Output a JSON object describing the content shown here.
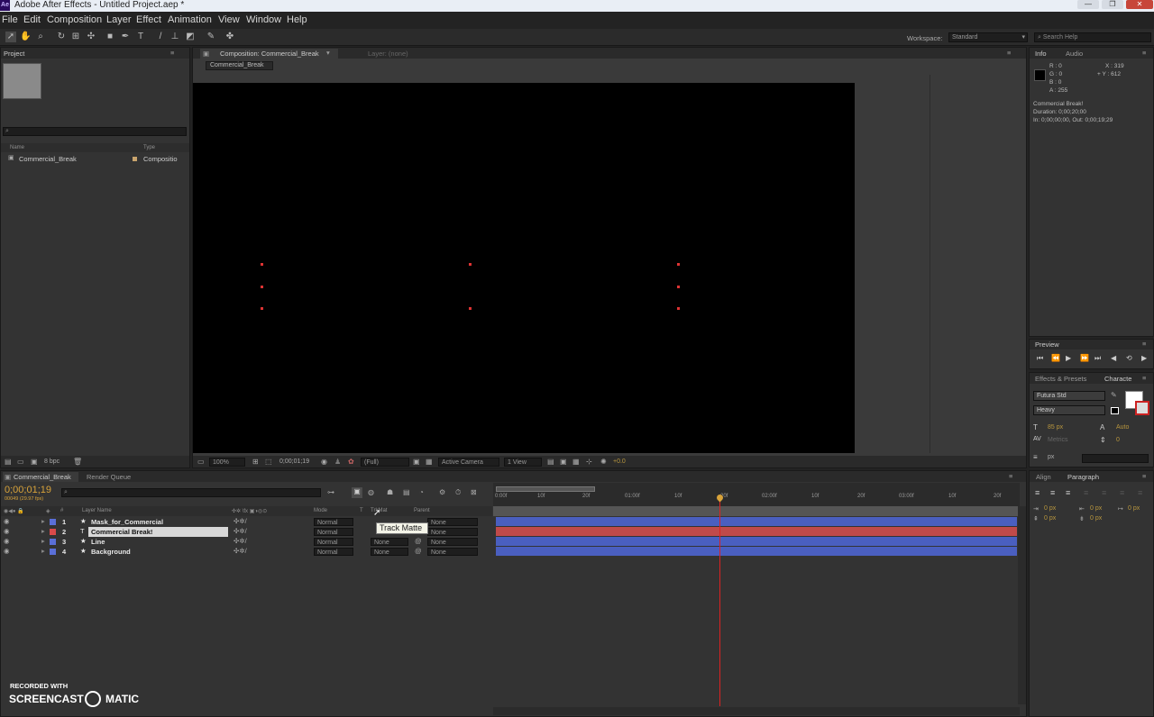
{
  "window": {
    "title": "Adobe After Effects - Untitled Project.aep *",
    "app_badge": "Ae"
  },
  "menu": [
    "File",
    "Edit",
    "Composition",
    "Layer",
    "Effect",
    "Animation",
    "View",
    "Window",
    "Help"
  ],
  "toolbar": {
    "workspace_label": "Workspace:",
    "workspace_value": "Standard",
    "search_placeholder": "Search Help"
  },
  "project": {
    "tab": "Project",
    "col_name": "Name",
    "col_type": "Type",
    "items": [
      {
        "name": "Commercial_Break",
        "type": "Compositio"
      }
    ],
    "bpc": "8 bpc"
  },
  "comp": {
    "tab": "Composition: Commercial_Break",
    "layer_tab": "Layer: (none)",
    "breadcrumb": "Commercial_Break",
    "zoom": "100%",
    "timecode": "0;00;01;19",
    "resolution": "(Full)",
    "camera": "Active Camera",
    "view": "1 View",
    "exposure": "+0.0"
  },
  "info": {
    "tab": "Info",
    "tab2": "Audio",
    "r": "R : 0",
    "g": "G : 0",
    "b": "B : 0",
    "a": "A : 255",
    "x": "X : 319",
    "y": "+ Y : 612",
    "line1": "Commercial Break!",
    "line2": "Duration: 0;00;20;00",
    "line3": "In: 0;00;00;00, Out: 0;00;19;29"
  },
  "preview": {
    "tab": "Preview"
  },
  "character": {
    "tab1": "Effects & Presets",
    "tab2": "Characte",
    "font": "Futura Std",
    "style": "Heavy",
    "size": "85 px",
    "leading": "Auto",
    "tracking": "0",
    "kerning": "Metrics",
    "unit": "px"
  },
  "paragraph": {
    "tab1": "Align",
    "tab2": "Paragraph",
    "v1": "0 px",
    "v2": "0 px",
    "v3": "0 px",
    "v4": "0 px",
    "v5": "0 px"
  },
  "timeline": {
    "tab": "Commercial_Break",
    "tab2": "Render Queue",
    "timecode": "0;00;01;19",
    "fps": "00049 (29.97 fps)",
    "col_layer": "Layer Name",
    "col_mode": "Mode",
    "col_t": "T",
    "col_trkmat": "TrkMat",
    "col_parent": "Parent",
    "tooltip": "Track Matte",
    "ticks": [
      "0:00f",
      "10f",
      "20f",
      "01:00f",
      "10f",
      "20f",
      "02:00f",
      "10f",
      "20f",
      "03:00f",
      "10f",
      "20f"
    ],
    "layers": [
      {
        "num": "1",
        "name": "Mask_for_Commercial",
        "mode": "Normal",
        "trkmat": "",
        "parent": "None",
        "label": "#5a6fd8",
        "bar": "#4a5fc0"
      },
      {
        "num": "2",
        "name": "Commercial Break!",
        "mode": "Normal",
        "trkmat": "N",
        "parent": "None",
        "label": "#d94a4a",
        "bar": "#c04a4a"
      },
      {
        "num": "3",
        "name": "Line",
        "mode": "Normal",
        "trkmat": "None",
        "parent": "None",
        "label": "#5a6fd8",
        "bar": "#4a5fc0"
      },
      {
        "num": "4",
        "name": "Background",
        "mode": "Normal",
        "trkmat": "None",
        "parent": "None",
        "label": "#5a6fd8",
        "bar": "#4a5fc0"
      }
    ]
  },
  "watermark": {
    "line1": "RECORDED WITH",
    "line2a": "SCREENCAST",
    "line2b": "MATIC"
  }
}
